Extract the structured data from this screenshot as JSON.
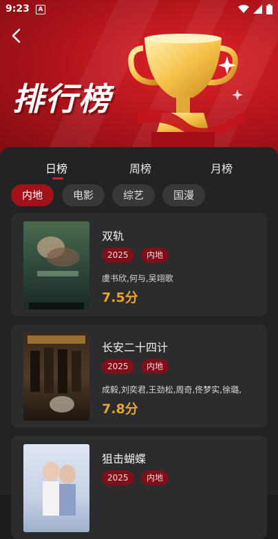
{
  "status_bar": {
    "time": "9:23",
    "a_label": "A"
  },
  "header": {
    "title": "排行榜",
    "back_icon": "chevron-left-icon"
  },
  "tabs": [
    {
      "label": "日榜",
      "active": true
    },
    {
      "label": "周榜",
      "active": false
    },
    {
      "label": "月榜",
      "active": false
    }
  ],
  "filters": [
    {
      "label": "内地",
      "active": true
    },
    {
      "label": "电影",
      "active": false
    },
    {
      "label": "综艺",
      "active": false
    },
    {
      "label": "国漫",
      "active": false
    }
  ],
  "items": [
    {
      "title": "双轨",
      "year": "2025",
      "region": "内地",
      "cast": "虞书欣,何与,吴翊歌",
      "score": "7.5分"
    },
    {
      "title": "长安二十四计",
      "year": "2025",
      "region": "内地",
      "cast": "成毅,刘奕君,王劲松,周奇,佟梦实,徐璐,",
      "score": "7.8分"
    },
    {
      "title": "狙击蝴蝶",
      "year": "2025",
      "region": "内地",
      "cast": "",
      "score": ""
    }
  ],
  "colors": {
    "accent": "#d51f2a",
    "tag_bg": "#7d1018",
    "score": "#e8a52a"
  }
}
